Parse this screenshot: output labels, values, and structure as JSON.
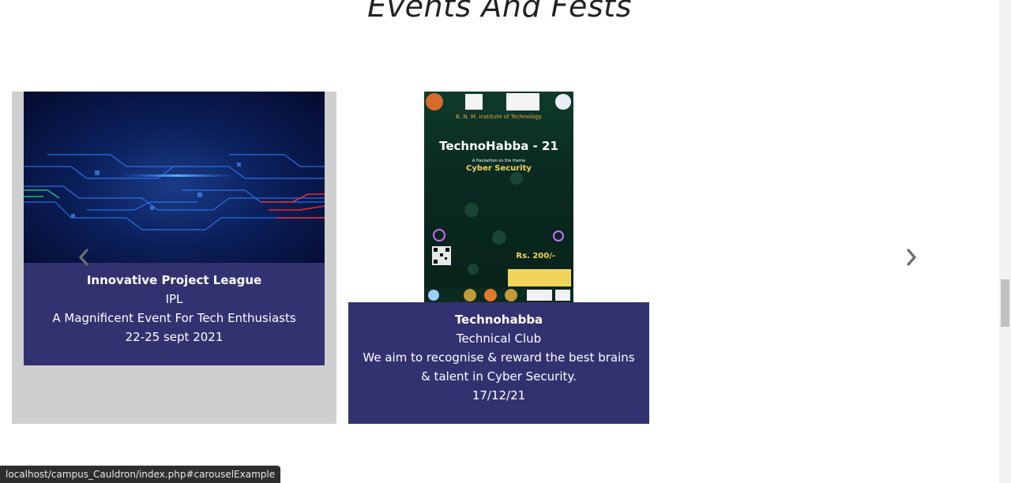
{
  "section": {
    "title": "Events And Fests"
  },
  "events": [
    {
      "title": "Innovative Project League",
      "club": "IPL",
      "description": "A Magnificent Event For Tech Enthusiasts",
      "date": "22-25 sept 2021"
    },
    {
      "title": "Technohabba",
      "club": "Technical Club",
      "description": "We aim to recognise & reward the best brains & talent in Cyber Security.",
      "date": "17/12/21"
    }
  ],
  "poster": {
    "institute": "B. N. M. Institute of Technology",
    "headline": "TechnoHabba - 21",
    "theme_intro": "A Hackathon on the theme",
    "theme": "Cyber Security",
    "fee": "Rs. 200/-"
  },
  "status_bar": {
    "url": "localhost/campus_Cauldron/index.php#carouselExample"
  },
  "colors": {
    "card_body": "#323270",
    "card_bg_left": "#cfcfcf",
    "arrow": "#6c6c6c"
  },
  "icons": {
    "prev": "chevron-left-icon",
    "next": "chevron-right-icon"
  }
}
